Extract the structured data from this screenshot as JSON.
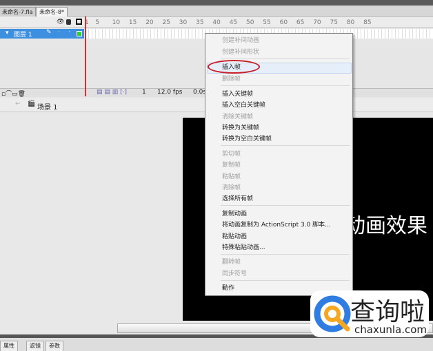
{
  "tabs": [
    "未命名-7.fla",
    "未命名-8*"
  ],
  "timeline": {
    "ticks": [
      "1",
      "5",
      "10",
      "15",
      "20",
      "25",
      "30",
      "35",
      "40",
      "45",
      "50",
      "55",
      "60",
      "65",
      "70",
      "75",
      "80",
      "85"
    ],
    "layer_name": "图层 1",
    "current_frame": "1",
    "fps": "12.0 fps",
    "time": "0.0s"
  },
  "scene": {
    "label": "场景 1"
  },
  "stage": {
    "text": "动画效果"
  },
  "menu": {
    "items": [
      {
        "label": "创建补间动画",
        "enabled": false
      },
      {
        "label": "创建补间形状",
        "enabled": false
      },
      {
        "label": "插入帧",
        "enabled": true
      },
      {
        "label": "删除帧",
        "enabled": false
      },
      {
        "label": "插入关键帧",
        "enabled": true
      },
      {
        "label": "插入空白关键帧",
        "enabled": true
      },
      {
        "label": "清除关键帧",
        "enabled": false
      },
      {
        "label": "转换为关键帧",
        "enabled": true
      },
      {
        "label": "转换为空白关键帧",
        "enabled": true
      },
      {
        "label": "剪切帧",
        "enabled": false
      },
      {
        "label": "复制帧",
        "enabled": false
      },
      {
        "label": "粘贴帧",
        "enabled": false
      },
      {
        "label": "清除帧",
        "enabled": false
      },
      {
        "label": "选择所有帧",
        "enabled": true
      },
      {
        "label": "复制动画",
        "enabled": true
      },
      {
        "label": "将动画复制为 ActionScript 3.0 脚本...",
        "enabled": true
      },
      {
        "label": "粘贴动画",
        "enabled": true
      },
      {
        "label": "特殊粘贴动画...",
        "enabled": true
      },
      {
        "label": "翻转帧",
        "enabled": false
      },
      {
        "label": "同步符号",
        "enabled": false
      },
      {
        "label": "動作",
        "enabled": true
      }
    ]
  },
  "panel_tabs": [
    "属性",
    "滤镜",
    "参数"
  ],
  "watermark": {
    "cn": "查询啦",
    "url": "chaxunla.com"
  },
  "colors": {
    "highlight": "#3d8fe0",
    "annotation": "#c8202a",
    "logo_blue": "#2f7de1",
    "logo_orange": "#f5a623"
  }
}
